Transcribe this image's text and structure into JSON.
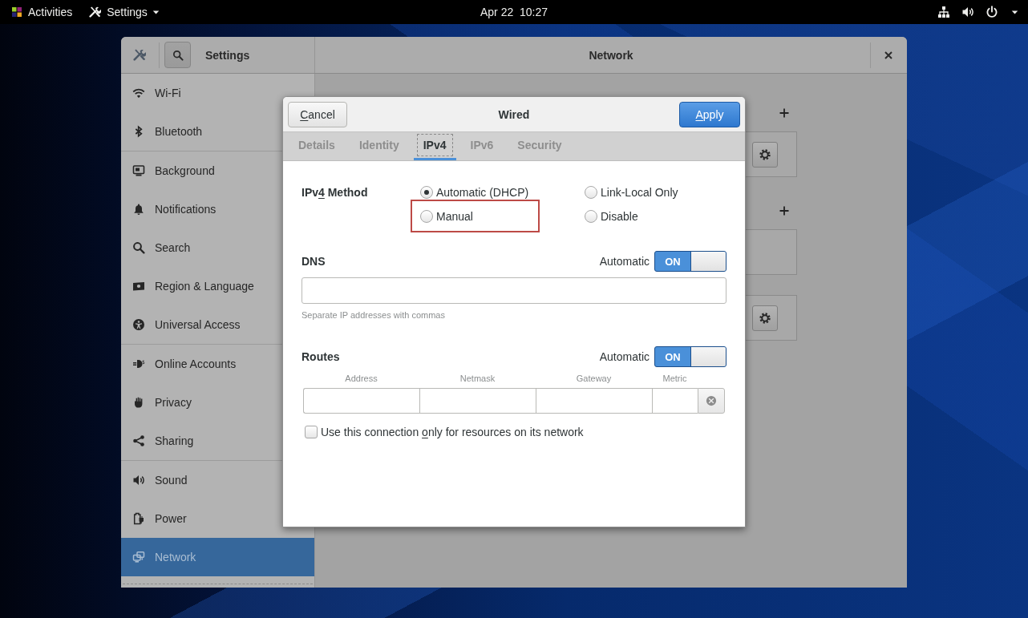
{
  "top_bar": {
    "activities": "Activities",
    "app_menu": "Settings",
    "clock": "Apr 22  10:27"
  },
  "settings_window": {
    "title": "Settings",
    "panel_title": "Network",
    "sidebar": {
      "groups": [
        {
          "items": [
            {
              "kind": "wifi",
              "label": "Wi-Fi",
              "selected": false
            },
            {
              "kind": "bluetooth",
              "label": "Bluetooth",
              "selected": false
            }
          ]
        },
        {
          "items": [
            {
              "kind": "background",
              "label": "Background",
              "selected": false
            },
            {
              "kind": "notifications",
              "label": "Notifications",
              "selected": false
            },
            {
              "kind": "search",
              "label": "Search",
              "selected": false
            },
            {
              "kind": "region",
              "label": "Region & Language",
              "selected": false
            },
            {
              "kind": "access",
              "label": "Universal Access",
              "selected": false
            }
          ]
        },
        {
          "items": [
            {
              "kind": "accounts",
              "label": "Online Accounts",
              "selected": false
            },
            {
              "kind": "privacy",
              "label": "Privacy",
              "selected": false
            },
            {
              "kind": "sharing",
              "label": "Sharing",
              "selected": false
            }
          ]
        },
        {
          "items": [
            {
              "kind": "sound",
              "label": "Sound",
              "selected": false
            },
            {
              "kind": "power",
              "label": "Power",
              "selected": false
            },
            {
              "kind": "network",
              "label": "Network",
              "selected": true
            }
          ]
        }
      ]
    },
    "network_panel": {
      "sections": [
        {
          "add_button": true,
          "settings_button": true
        },
        {
          "add_button": true,
          "settings_button": false
        },
        {
          "add_button": false,
          "settings_button": true
        }
      ]
    }
  },
  "dialog": {
    "title": "Wired",
    "cancel_button": {
      "access_key": "C",
      "label_rest": "ancel"
    },
    "apply_button": {
      "access_key": "A",
      "label_rest": "pply"
    },
    "tabs": [
      {
        "label": "Details",
        "selected": false,
        "focused": false
      },
      {
        "label": "Identity",
        "selected": false,
        "focused": false
      },
      {
        "label": "IPv4",
        "selected": true,
        "focused": true
      },
      {
        "label": "IPv6",
        "selected": false,
        "focused": false
      },
      {
        "label": "Security",
        "selected": false,
        "focused": false
      }
    ],
    "ipv4_method": {
      "label": {
        "label_start": "IPv",
        "access_key": "4",
        "label_rest": " Method"
      },
      "options": [
        {
          "label": "Automatic (DHCP)",
          "selected": true,
          "highlighted": false
        },
        {
          "label": "Link-Local Only",
          "selected": false,
          "highlighted": false
        },
        {
          "label": "Manual",
          "selected": false,
          "highlighted": true
        },
        {
          "label": "Disable",
          "selected": false,
          "highlighted": false
        }
      ]
    },
    "dns": {
      "title": "DNS",
      "automatic_label": "Automatic",
      "switch": {
        "label": "ON",
        "on": true
      },
      "hint": "Separate IP addresses with commas"
    },
    "routes": {
      "title": "Routes",
      "automatic_label": "Automatic",
      "switch": {
        "label": "ON",
        "on": true
      },
      "columns": [
        "Address",
        "Netmask",
        "Gateway",
        "Metric"
      ]
    },
    "local_only": {
      "checked": false,
      "label_start": "Use this connection ",
      "access_key": "o",
      "label_rest": "nly for resources on its network"
    }
  }
}
